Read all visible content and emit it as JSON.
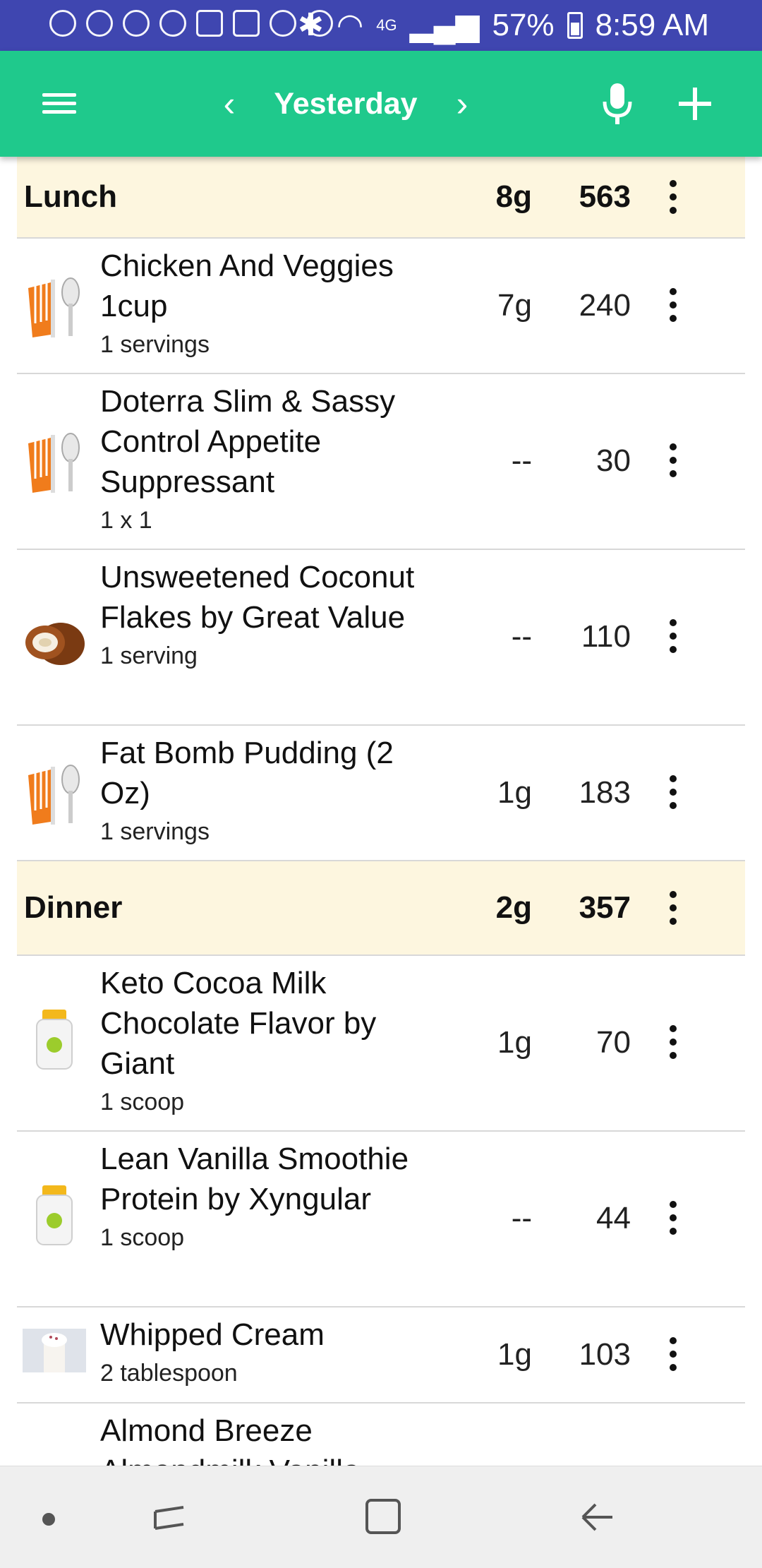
{
  "status_bar": {
    "battery": "57%",
    "time": "8:59 AM",
    "network": "4G"
  },
  "app_bar": {
    "date_label": "Yesterday",
    "icons": [
      "menu-icon",
      "chevron-left-icon",
      "chevron-right-icon",
      "microphone-icon",
      "plus-icon"
    ]
  },
  "sections": [
    {
      "title": "Lunch",
      "carbs": "8g",
      "calories": "563",
      "items": [
        {
          "name": "Chicken And Veggies 1cup",
          "serving": "1 servings",
          "carbs": "7g",
          "calories": "240",
          "icon": "utensils-icon"
        },
        {
          "name": "Doterra Slim & Sassy Control Appetite Suppressant",
          "serving": "1 x 1",
          "carbs": "--",
          "calories": "30",
          "icon": "utensils-icon"
        },
        {
          "name": "Unsweetened Coconut Flakes by Great Value",
          "serving": "1 serving",
          "carbs": "--",
          "calories": "110",
          "icon": "coconut-icon"
        },
        {
          "name": "Fat Bomb Pudding (2 Oz)",
          "serving": "1 servings",
          "carbs": "1g",
          "calories": "183",
          "icon": "utensils-icon"
        }
      ]
    },
    {
      "title": "Dinner",
      "carbs": "2g",
      "calories": "357",
      "items": [
        {
          "name": "Keto Cocoa Milk Chocolate Flavor by Giant",
          "serving": "1 scoop",
          "carbs": "1g",
          "calories": "70",
          "icon": "supplement-bottle-icon"
        },
        {
          "name": "Lean Vanilla Smoothie Protein by Xyngular",
          "serving": "1 scoop",
          "carbs": "--",
          "calories": "44",
          "icon": "supplement-bottle-icon"
        },
        {
          "name": "Whipped Cream",
          "serving": "2 tablespoon",
          "carbs": "1g",
          "calories": "103",
          "icon": "whipped-cream-photo"
        },
        {
          "name": "Almond Breeze Almondmilk Vanilla",
          "serving": "",
          "carbs": "",
          "calories": "",
          "icon": "none"
        }
      ]
    }
  ]
}
